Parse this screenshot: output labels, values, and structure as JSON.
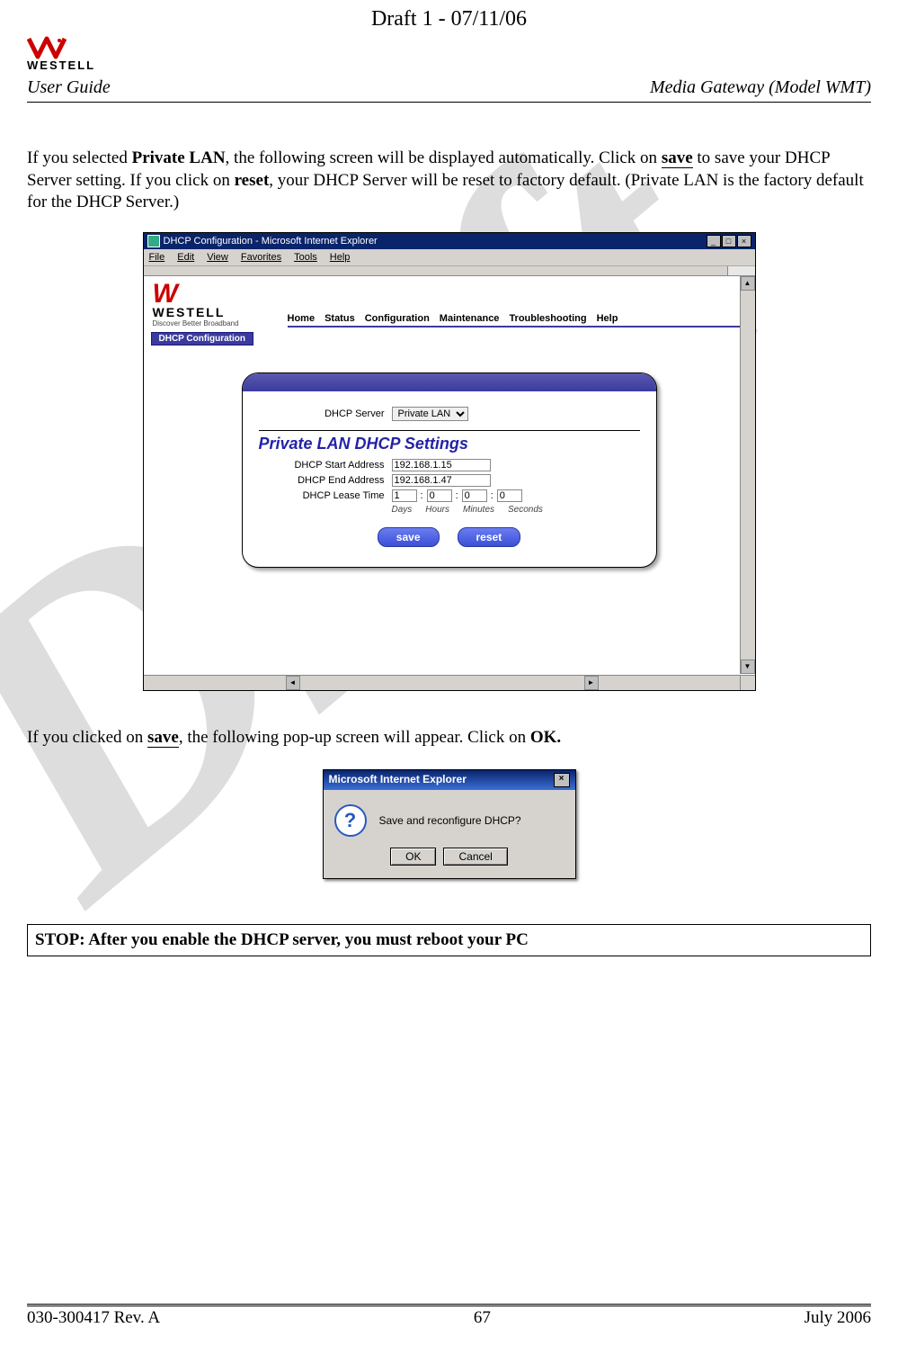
{
  "draft_header": "Draft 1 - 07/11/06",
  "header": {
    "user_guide": "User Guide",
    "model": "Media Gateway (Model WMT)"
  },
  "para1_pre": "If you selected ",
  "para1_bold1": "Private LAN",
  "para1_mid1": ", the following screen will be displayed automatically. Click on ",
  "para1_bold2": "save",
  "para1_mid2": " to save your DHCP Server setting. If you click on ",
  "para1_bold3": "reset",
  "para1_end": ", your DHCP Server will be reset to factory default. (Private LAN is the factory default for the DHCP Server.)",
  "screenshot1": {
    "title": "DHCP Configuration - Microsoft Internet Explorer",
    "menu": [
      "File",
      "Edit",
      "View",
      "Favorites",
      "Tools",
      "Help"
    ],
    "logo_brand": "WESTELL",
    "logo_tag": "Discover Better Broadband",
    "nav": [
      "Home",
      "Status",
      "Configuration",
      "Maintenance",
      "Troubleshooting",
      "Help"
    ],
    "breadcrumb": "DHCP Configuration",
    "form": {
      "server_label": "DHCP Server",
      "server_value": "Private LAN",
      "section": "Private LAN DHCP Settings",
      "start_label": "DHCP Start Address",
      "start_value": "192.168.1.15",
      "end_label": "DHCP End Address",
      "end_value": "192.168.1.47",
      "lease_label": "DHCP Lease Time",
      "days": "1",
      "hours": "0",
      "minutes": "0",
      "seconds": "0",
      "days_l": "Days",
      "hours_l": "Hours",
      "minutes_l": "Minutes",
      "seconds_l": "Seconds",
      "save": "save",
      "reset": "reset"
    }
  },
  "para2_pre": "If you clicked on ",
  "para2_bold": "save",
  "para2_mid": ", the following pop-up screen will appear. Click on ",
  "para2_bold2": "OK.",
  "dialog": {
    "title": "Microsoft Internet Explorer",
    "message": "Save and reconfigure DHCP?",
    "ok": "OK",
    "cancel": "Cancel"
  },
  "stop": "STOP: After you enable the DHCP server, you must reboot your PC",
  "footer": {
    "left": "030-300417 Rev. A",
    "center": "67",
    "right": "July 2006"
  },
  "watermark": "Draft"
}
